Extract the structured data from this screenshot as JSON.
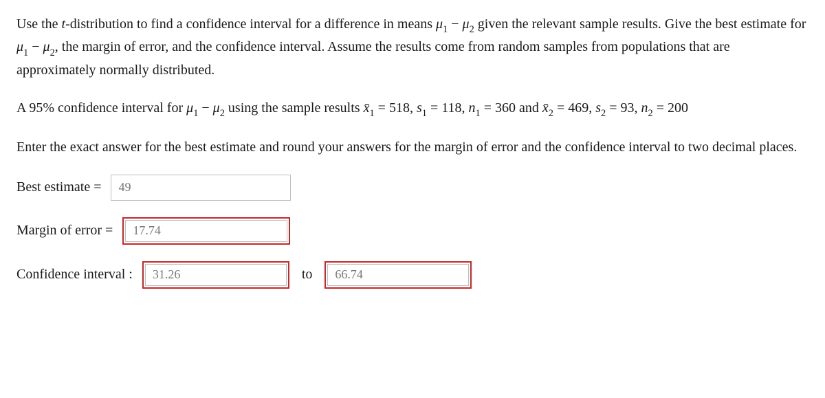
{
  "intro": {
    "p1_a": "Use the ",
    "p1_t": "t",
    "p1_b": "-distribution to find a confidence interval for a difference in means ",
    "p1_c": " given the relevant sample results. Give the best estimate for ",
    "p1_d": ", the margin of error, and the confidence interval. Assume the results come from random samples from populations that are approximately normally distributed.",
    "mu1": "μ",
    "sub1": "1",
    "minus": " − ",
    "mu2": "μ",
    "sub2": "2"
  },
  "problem": {
    "a": "A 95% confidence interval for ",
    "b": " using the sample results ",
    "x1": "x̄",
    "x1sub": "1",
    "eq": " = ",
    "v_x1": "518",
    "comma": ", ",
    "s1": "s",
    "s1sub": "1",
    "v_s1": "118",
    "n1": "n",
    "n1sub": "1",
    "v_n1": "360",
    "and": " and ",
    "x2": "x̄",
    "x2sub": "2",
    "v_x2": "469",
    "s2": "s",
    "s2sub": "2",
    "v_s2": "93",
    "n2": "n",
    "n2sub": "2",
    "v_n2": "200"
  },
  "instruction": "Enter the exact answer for the best estimate and round your answers for the margin of error and the confidence interval to two decimal places.",
  "labels": {
    "best_estimate": "Best estimate =",
    "margin_of_error": "Margin of error =",
    "ci": "Confidence interval :",
    "to": "to"
  },
  "values": {
    "best_estimate": "49",
    "margin_of_error": "17.74",
    "ci_low": "31.26",
    "ci_high": "66.74"
  }
}
